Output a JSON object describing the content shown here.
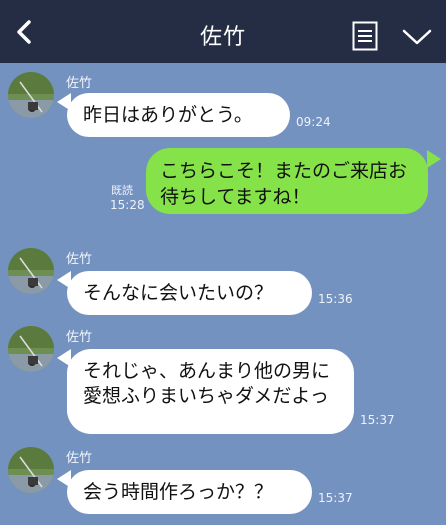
{
  "header": {
    "title": "佐竹",
    "back_icon": "chevron-left-icon",
    "memo_icon": "note-list-icon",
    "menu_icon": "chevron-down-icon"
  },
  "colors": {
    "background": "#7392c0",
    "header": "#242d44",
    "sent_bubble": "#85e249",
    "received_bubble": "#ffffff"
  },
  "messages": [
    {
      "sender": "佐竹",
      "text": "昨日はありがとう。",
      "time": "09:24"
    },
    {
      "text": "こちらこそ！またのご来店お待ちしてますね！",
      "read_label": "既読",
      "time": "15:28"
    },
    {
      "sender": "佐竹",
      "text": "そんなに会いたいの？",
      "time": "15:36"
    },
    {
      "sender": "佐竹",
      "text": "それじゃ、あんまり他の男に愛想ふりまいちゃダメだよっ",
      "time": "15:37"
    },
    {
      "sender": "佐竹",
      "text": "会う時間作ろっか？？",
      "time": "15:37"
    }
  ]
}
